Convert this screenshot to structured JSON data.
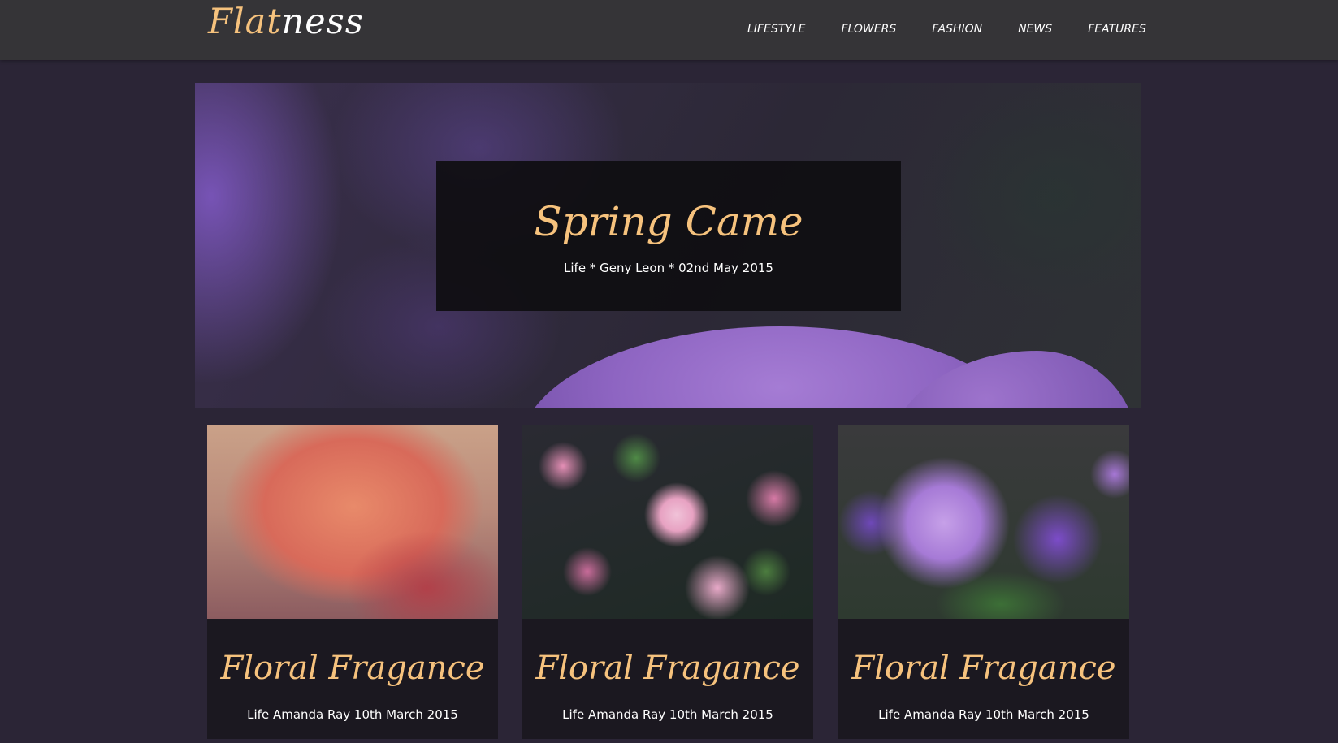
{
  "header": {
    "logo_part1": "Flat",
    "logo_part2": "ness",
    "nav": [
      "LIFESTYLE",
      "FLOWERS",
      "FASHION",
      "NEWS",
      "FEATURES"
    ]
  },
  "hero": {
    "title": "Spring Came",
    "meta": "Life * Geny Leon * 02nd May 2015"
  },
  "cards": [
    {
      "title": "Floral Fragance",
      "meta": "Life Amanda Ray 10th March 2015",
      "image": "orange-lily-photo"
    },
    {
      "title": "Floral Fragance",
      "meta": "Life Amanda Ray 10th March 2015",
      "image": "pink-blossom-photo"
    },
    {
      "title": "Floral Fragance",
      "meta": "Life Amanda Ray 10th March 2015",
      "image": "purple-petunia-photo"
    }
  ],
  "colors": {
    "accent": "#f6c27d",
    "background": "#2b2536",
    "header": "#353437",
    "card": "#1b1820"
  }
}
